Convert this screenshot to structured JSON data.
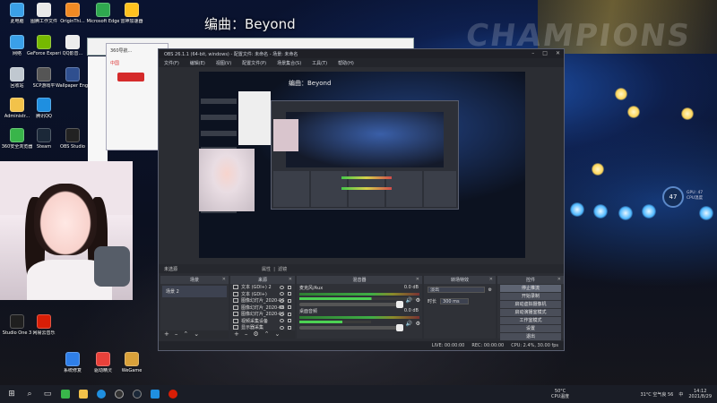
{
  "wallpaper": {
    "caption": "编曲：Beyond"
  },
  "desktop_icons": [
    {
      "label": "此电脑",
      "color": "#3aa0e8"
    },
    {
      "label": "图腾工作文件",
      "color": "#e9e9e9"
    },
    {
      "label": "OriginThi...",
      "color": "#f08a24"
    },
    {
      "label": "Microsoft Edge",
      "color": "#2fa84f"
    },
    {
      "label": "雷神加速器",
      "color": "#ffc21f"
    },
    {
      "label": "网络",
      "color": "#3aa0e8"
    },
    {
      "label": "GeForce Experience",
      "color": "#76b900"
    },
    {
      "label": "QQ影音...",
      "color": "#ececec"
    },
    {
      "label": "回收站",
      "color": "#c0c8d0"
    },
    {
      "label": "SCP游戏平",
      "color": "#555"
    },
    {
      "label": "Wallpaper Engine:...",
      "color": "#2f4f8f"
    },
    {
      "label": "Administr...",
      "color": "#f2c24a"
    },
    {
      "label": "腾讯QQ",
      "color": "#1f8fe0"
    },
    {
      "label": "360安全浏览器",
      "color": "#39b54a"
    },
    {
      "label": "Steam",
      "color": "#1b2838"
    },
    {
      "label": "OBS Studio",
      "color": "#222"
    },
    {
      "label": "Studio One 3",
      "color": "#1f1f1f"
    },
    {
      "label": "网易云音乐",
      "color": "#d81e06"
    },
    {
      "label": "系统修复",
      "color": "#2f7fe8"
    },
    {
      "label": "驱动精灵",
      "color": "#e8413a"
    },
    {
      "label": "WeGame",
      "color": "#d9a13a"
    }
  ],
  "browser": {
    "url": "360导航...",
    "tab_label": "中国"
  },
  "obs": {
    "title": "OBS 26.1.1 (64-bit, windows) - 配置文件: 未命名 - 场景: 未命名",
    "menus": [
      "文件(F)",
      "编辑(E)",
      "视图(V)",
      "配置文件(P)",
      "场景集合(S)",
      "工具(T)",
      "帮助(H)"
    ],
    "preview_caption": "编曲：Beyond",
    "scene_bar": {
      "label": "未选源",
      "props": "属性",
      "filters": "滤镜"
    },
    "scenes": {
      "title": "场景",
      "items": [
        "场景 2"
      ]
    },
    "sources": {
      "title": "来源",
      "items": [
        {
          "name": "文本 (GDI+) 2",
          "type": "T"
        },
        {
          "name": "文本 (GDI+)",
          "type": "T"
        },
        {
          "name": "图像幻灯片_2020-06",
          "type": "img"
        },
        {
          "name": "图像幻灯片_2020-06",
          "type": "img"
        },
        {
          "name": "图像幻灯片_2020-06",
          "type": "img"
        },
        {
          "name": "视频采集设备",
          "type": "cam"
        },
        {
          "name": "显示器采集",
          "type": "mon"
        }
      ]
    },
    "mixer": {
      "title": "混音器",
      "channels": [
        {
          "name": "麦克风/Aux",
          "db": "0.0 dB",
          "level": 1.0
        },
        {
          "name": "桌面音频",
          "db": "0.0 dB",
          "level": 0.6
        }
      ]
    },
    "transitions": {
      "title": "转场特效",
      "current": "淡出",
      "duration_label": "时长",
      "duration": "300 ms"
    },
    "controls": {
      "title": "控件",
      "buttons": [
        "停止推流",
        "开始录制",
        "启动虚拟摄像机",
        "启动演播室模式",
        "工作室模式",
        "设置",
        "退出"
      ]
    },
    "status": {
      "live_label": "LIVE: 00:00:00",
      "rec_label": "REC: 00:00:00",
      "cpu": "CPU: 2.4%, 30.00 fps"
    }
  },
  "perf_widget": {
    "percent": "47",
    "label1": "GPU: 47",
    "label2": "CPU温度"
  },
  "taskbar": {
    "cpu_temp": "50°C",
    "cpu_temp_label": "CPU温度",
    "weather": "31°C 空气良 56",
    "ime": "中",
    "time": "14:12",
    "date": "2021/8/29"
  },
  "colors": {
    "obs_bg": "#2b2d33",
    "accent_meter_green": "#3fae45",
    "accent_red": "#d81e06"
  }
}
